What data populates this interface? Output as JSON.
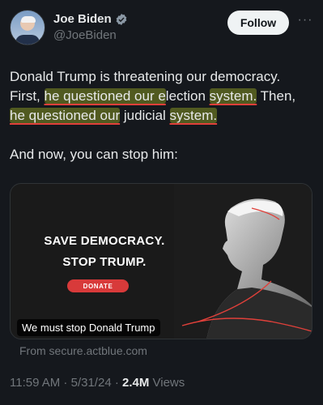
{
  "author": {
    "display_name": "Joe Biden",
    "handle": "@JoeBiden",
    "follow_label": "Follow",
    "verified_icon": "verified-badge-icon",
    "more_icon": "more-horizontal-icon"
  },
  "tweet": {
    "p1_a": "Donald Trump is threatening our democracy. First, ",
    "p1_hl1": "he questioned our e",
    "p1_b": "lection ",
    "p1_hl2": "system.",
    "p1_c": " Then, ",
    "p1_hl3": "he questioned our",
    "p1_d": " judicial ",
    "p1_hl4": "system.",
    "p2": "And now, you can stop him:"
  },
  "media": {
    "headline_1": "SAVE DEMOCRACY.",
    "headline_2": "STOP TRUMP.",
    "donate_label": "DONATE",
    "caption": "We must stop Donald Trump",
    "source": "From secure.actblue.com"
  },
  "meta": {
    "time": "11:59 AM",
    "sep1": " · ",
    "date": "5/31/24",
    "sep2": " · ",
    "views_count": "2.4M",
    "views_label": " Views"
  },
  "colors": {
    "background": "#15181d",
    "highlight": "#c4d628",
    "annotation_red": "#e0403a",
    "donate_red": "#d83a3a",
    "verified_blue": "#8b98a5"
  }
}
